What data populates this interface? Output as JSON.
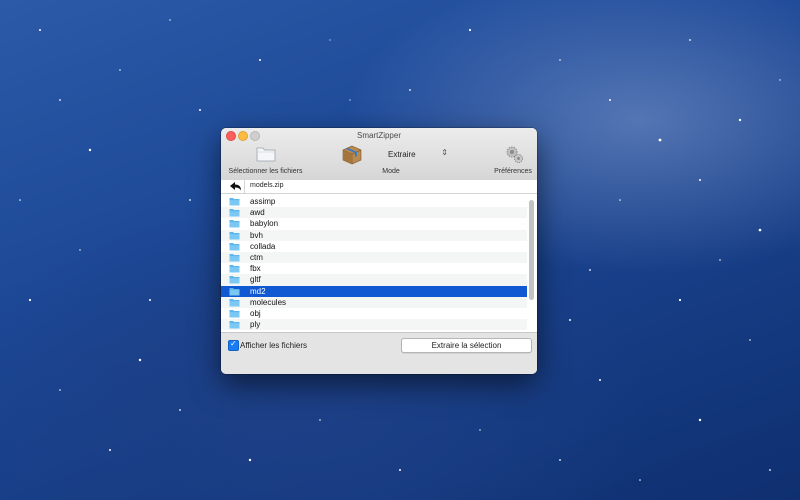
{
  "window": {
    "title": "SmartZipper"
  },
  "toolbar": {
    "select_files_label": "Sélectionner les fichiers",
    "mode_label": "Mode",
    "mode_value": "Extraire",
    "preferences_label": "Préférences"
  },
  "path": {
    "current": "models.zip"
  },
  "files": [
    {
      "name": "assimp"
    },
    {
      "name": "awd"
    },
    {
      "name": "babylon"
    },
    {
      "name": "bvh"
    },
    {
      "name": "collada"
    },
    {
      "name": "ctm"
    },
    {
      "name": "fbx"
    },
    {
      "name": "gltf"
    },
    {
      "name": "md2",
      "selected": true
    },
    {
      "name": "molecules"
    },
    {
      "name": "obj"
    },
    {
      "name": "ply"
    }
  ],
  "bottom": {
    "show_files_label": "Afficher les fichiers",
    "show_files_checked": true,
    "extract_button": "Extraire la sélection"
  },
  "colors": {
    "selection": "#1159d2",
    "folder": "#5bb6ee",
    "checkbox": "#1a7cf5"
  },
  "icons": [
    "folder-icon",
    "package-icon",
    "gears-icon",
    "back-arrow-icon"
  ]
}
